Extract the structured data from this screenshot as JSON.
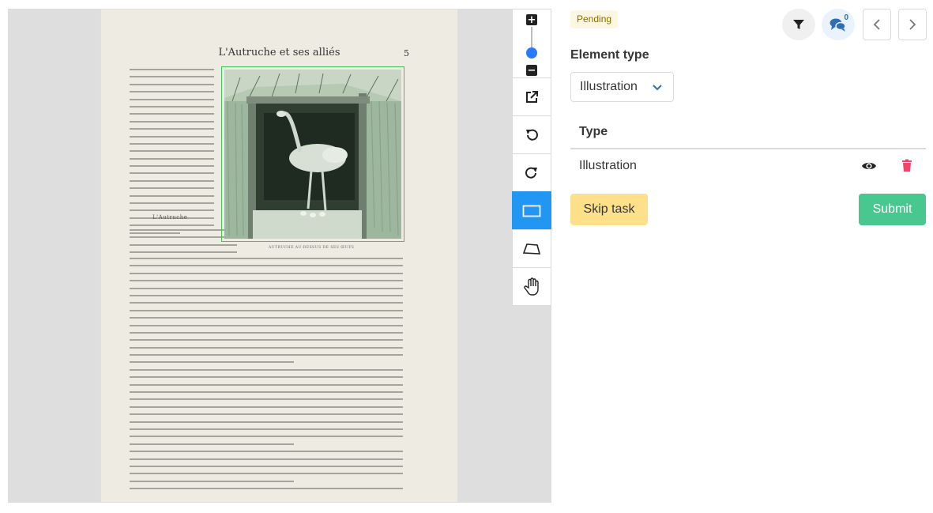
{
  "status": {
    "label": "Pending"
  },
  "header": {
    "filter_icon": "filter-icon",
    "comments_icon": "comments-icon",
    "comments_count": "0",
    "prev_icon": "chevron-left-icon",
    "next_icon": "chevron-right-icon"
  },
  "document": {
    "running_title": "L'Autruche et ses alliés",
    "page_number": "5",
    "subheading": "L'Autruche",
    "caption": "AUTRUCHE AU-DESSUS DE SES ŒUFS"
  },
  "toolbar": {
    "zoom_in": "+",
    "zoom_out": "−",
    "zoom_level": 0.2,
    "tools": [
      "external-link-icon",
      "rotate-left-icon",
      "rotate-right-icon",
      "rectangle-icon",
      "polygon-icon",
      "hand-icon"
    ],
    "active_tool": "rectangle-icon"
  },
  "form": {
    "element_type_label": "Element type",
    "element_type_value": "Illustration",
    "table_header": "Type",
    "rows": [
      {
        "type": "Illustration"
      }
    ]
  },
  "actions": {
    "skip_label": "Skip task",
    "submit_label": "Submit"
  },
  "colors": {
    "accent": "#2196f3",
    "submit": "#48c78e",
    "skip": "#ffe08a",
    "delete": "#f14668",
    "annotation": "#42c35a"
  }
}
